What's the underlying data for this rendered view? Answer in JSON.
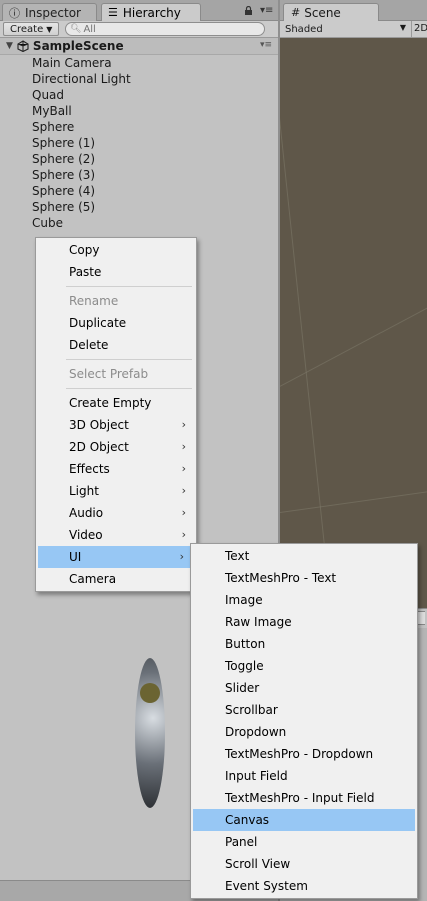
{
  "tabs": {
    "inspector": "Inspector",
    "hierarchy": "Hierarchy",
    "scene": "Scene"
  },
  "toolbar": {
    "create_label": "Create",
    "search_placeholder": "All",
    "shading_mode": "Shaded",
    "twod_label": "2D"
  },
  "hierarchy": {
    "scene_name": "SampleScene",
    "items": [
      "Main Camera",
      "Directional Light",
      "Quad",
      "MyBall",
      "Sphere",
      "Sphere (1)",
      "Sphere (2)",
      "Sphere (3)",
      "Sphere (4)",
      "Sphere (5)",
      "Cube"
    ]
  },
  "context_menu": {
    "copy": "Copy",
    "paste": "Paste",
    "rename": "Rename",
    "duplicate": "Duplicate",
    "delete": "Delete",
    "select_prefab": "Select Prefab",
    "create_empty": "Create Empty",
    "object_3d": "3D Object",
    "object_2d": "2D Object",
    "effects": "Effects",
    "light": "Light",
    "audio": "Audio",
    "video": "Video",
    "ui": "UI",
    "camera": "Camera"
  },
  "ui_submenu": {
    "items": [
      "Text",
      "TextMeshPro - Text",
      "Image",
      "Raw Image",
      "Button",
      "Toggle",
      "Slider",
      "Scrollbar",
      "Dropdown",
      "TextMeshPro - Dropdown",
      "Input Field",
      "TextMeshPro - Input Field",
      "Canvas",
      "Panel",
      "Scroll View",
      "Event System"
    ],
    "highlighted": "Canvas"
  },
  "colors": {
    "highlight": "#97c7f4",
    "menu_bg": "#f0f0f0",
    "panel_bg": "#c2c2c2",
    "scene_bg": "#5f5749"
  }
}
